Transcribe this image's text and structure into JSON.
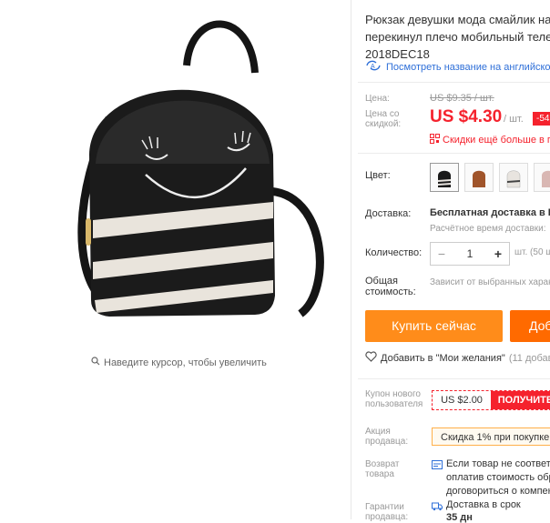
{
  "product": {
    "title_line1": "Рюкзак девушки мода смайлик на",
    "title_line2": "перекинул плечо мобильный теле",
    "title_line3": "2018DEC18",
    "translate_link": "Посмотреть название на английском",
    "hover_hint": "Наведите курсор, чтобы увеличить"
  },
  "price": {
    "price_label": "Цена:",
    "old_price": "US $9.35 / шт.",
    "discount_label": "Цена со скидкой:",
    "price": "US $4.30",
    "per_unit": "/ шт.",
    "discount_badge": "-54",
    "more_discounts": "Скидки ещё больше в п"
  },
  "options": {
    "color_label": "Цвет:",
    "colors": [
      "black",
      "brown",
      "white",
      "pink"
    ],
    "colors_hex": [
      "#1a1a1a",
      "#a0542a",
      "#e8e4df",
      "#d9b7b3"
    ],
    "delivery_label": "Доставка:",
    "delivery_main": "Бесплатная доставка в Ru",
    "delivery_sub": "Расчётное время доставки:",
    "quantity_label": "Количество:",
    "quantity_minus": "−",
    "quantity_value": "1",
    "quantity_plus": "+",
    "quantity_suffix": "шт. (50 ш",
    "total_label": "Общая стоимость:",
    "total_value": "Зависит от выбранных харак"
  },
  "actions": {
    "buy_now": "Купить сейчас",
    "add_to_cart": "Доб",
    "wishlist": "Добавить в \"Мои желания\"",
    "wishlist_count": "(11 добав"
  },
  "extras": {
    "coupon_label": "Купон нового пользователя",
    "coupon_value": "US $2.00",
    "coupon_button": "ПОЛУЧИТЕ",
    "promo_label": "Акция продавца:",
    "promo_value": "Скидка 1% при покупке 2",
    "return_label": "Возврат товара",
    "return_line1": "Если товар не соответст",
    "return_line2": "оплатив стоимость обр",
    "return_line3": "договориться о компен",
    "guarantee_label": "Гарантии продавца:",
    "guarantee_value": "Доставка в срок",
    "guarantee_days": "35 дн"
  },
  "colors": {
    "accent_red": "#f5222d",
    "buy_orange": "#ff8c1a",
    "cart_orange": "#ff6a00",
    "link_blue": "#2e6fd8"
  }
}
